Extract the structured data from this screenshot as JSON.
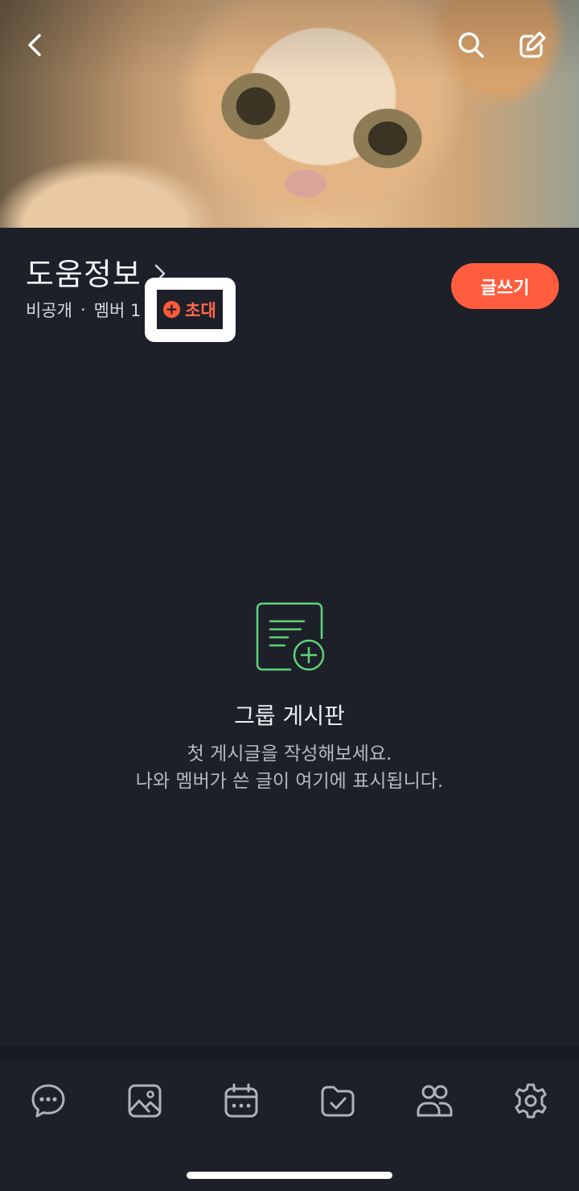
{
  "header": {
    "back_icon": "chevron-left-icon",
    "search_icon": "search-icon",
    "edit_icon": "edit-icon"
  },
  "group": {
    "name": "도움정보",
    "privacy": "비공개",
    "separator": "·",
    "member_count": "멤버 1",
    "invite_label": "초대",
    "write_button": "글쓰기"
  },
  "empty_state": {
    "title": "그룹 게시판",
    "line1": "첫 게시글을 작성해보세요.",
    "line2": "나와 멤버가 쓴 글이 여기에 표시됩니다.",
    "icon_color": "#5fd37a"
  },
  "tabs": [
    {
      "icon": "chat-icon"
    },
    {
      "icon": "photo-icon"
    },
    {
      "icon": "calendar-icon"
    },
    {
      "icon": "folder-check-icon"
    },
    {
      "icon": "members-icon"
    },
    {
      "icon": "settings-icon"
    }
  ],
  "colors": {
    "accent": "#ff5d3e",
    "background": "#1e2029"
  }
}
